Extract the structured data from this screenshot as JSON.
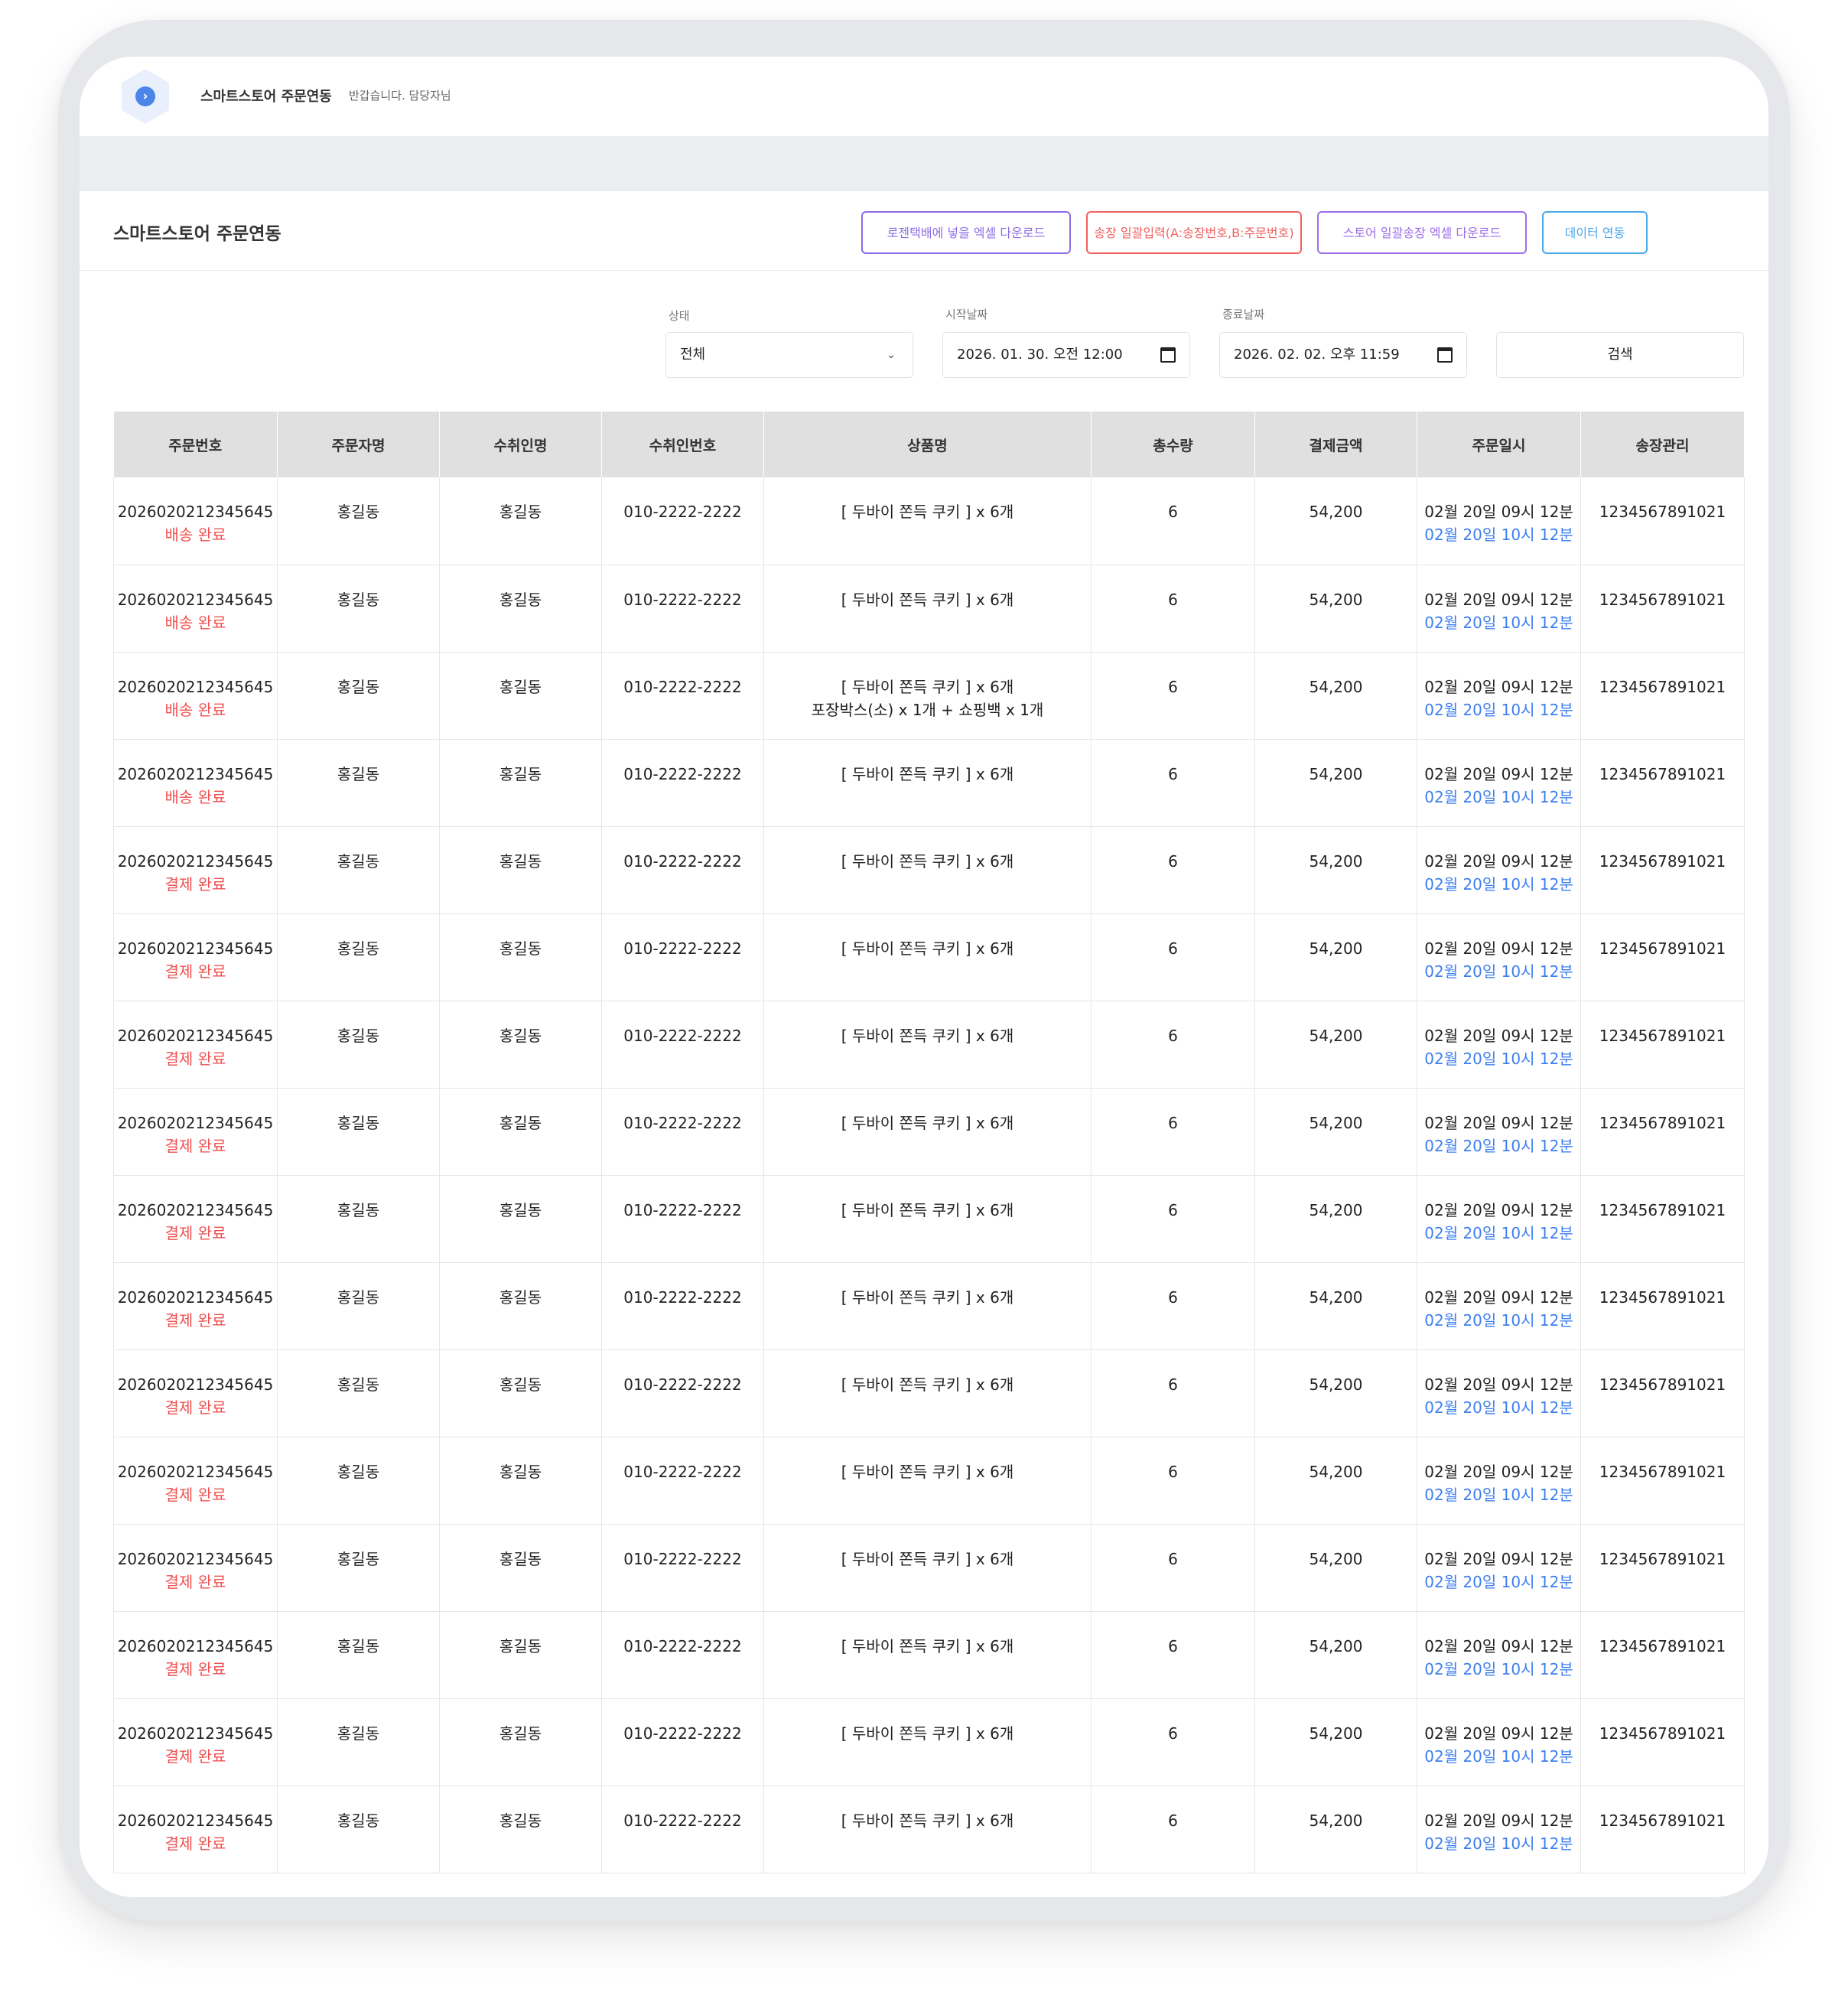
{
  "app": {
    "title": "스마트스토어 주문연동",
    "greeting": "반갑습니다. 담당자님",
    "logo_icon": "chevron-right-icon",
    "logo_glyph": "›"
  },
  "section": {
    "title": "스마트스토어 주문연동",
    "buttons": {
      "excel_download": "로젠택배에 넣을 엑셀 다운로드",
      "invoice_bulk": "송장 일괄입력(A:송장번호,B:주문번호)",
      "store_invoice_download": "스토어 일괄송장 엑셀 다운로드",
      "data_sync": "데이터 연동"
    }
  },
  "filters": {
    "status_label": "상태",
    "status_value": "전체",
    "start_label": "시작날짜",
    "start_value": "2026. 01. 30. 오전 12:00",
    "end_label": "종료날짜",
    "end_value": "2026. 02. 02. 오후 11:59",
    "search_label": "검색",
    "caret_glyph": "⌄"
  },
  "table": {
    "headers": [
      "주문번호",
      "주문자명",
      "수취인명",
      "수취인번호",
      "상품명",
      "총수량",
      "결제금액",
      "주문일시",
      "송장관리"
    ],
    "rows": [
      {
        "order_no": "2026020212345645",
        "status": "배송 완료",
        "buyer": "홍길동",
        "receiver": "홍길동",
        "phone": "010-2222-2222",
        "product": "[ 두바이 쫀득 쿠키 ] x 6개",
        "product_extra": "",
        "qty": "6",
        "amount": "54,200",
        "order_dt": "02월 20일 09시 12분",
        "update_dt": "02월 20일 10시 12분",
        "invoice": "1234567891021"
      },
      {
        "order_no": "2026020212345645",
        "status": "배송 완료",
        "buyer": "홍길동",
        "receiver": "홍길동",
        "phone": "010-2222-2222",
        "product": "[ 두바이 쫀득 쿠키 ] x 6개",
        "product_extra": "",
        "qty": "6",
        "amount": "54,200",
        "order_dt": "02월 20일 09시 12분",
        "update_dt": "02월 20일 10시 12분",
        "invoice": "1234567891021"
      },
      {
        "order_no": "2026020212345645",
        "status": "배송 완료",
        "buyer": "홍길동",
        "receiver": "홍길동",
        "phone": "010-2222-2222",
        "product": "[ 두바이 쫀득 쿠키 ] x 6개",
        "product_extra": "포장박스(소) x 1개 + 쇼핑백 x 1개",
        "qty": "6",
        "amount": "54,200",
        "order_dt": "02월 20일 09시 12분",
        "update_dt": "02월 20일 10시 12분",
        "invoice": "1234567891021"
      },
      {
        "order_no": "2026020212345645",
        "status": "배송 완료",
        "buyer": "홍길동",
        "receiver": "홍길동",
        "phone": "010-2222-2222",
        "product": "[ 두바이 쫀득 쿠키 ] x 6개",
        "product_extra": "",
        "qty": "6",
        "amount": "54,200",
        "order_dt": "02월 20일 09시 12분",
        "update_dt": "02월 20일 10시 12분",
        "invoice": "1234567891021"
      },
      {
        "order_no": "2026020212345645",
        "status": "결제 완료",
        "buyer": "홍길동",
        "receiver": "홍길동",
        "phone": "010-2222-2222",
        "product": "[ 두바이 쫀득 쿠키 ] x 6개",
        "product_extra": "",
        "qty": "6",
        "amount": "54,200",
        "order_dt": "02월 20일 09시 12분",
        "update_dt": "02월 20일 10시 12분",
        "invoice": "1234567891021"
      },
      {
        "order_no": "2026020212345645",
        "status": "결제 완료",
        "buyer": "홍길동",
        "receiver": "홍길동",
        "phone": "010-2222-2222",
        "product": "[ 두바이 쫀득 쿠키 ] x 6개",
        "product_extra": "",
        "qty": "6",
        "amount": "54,200",
        "order_dt": "02월 20일 09시 12분",
        "update_dt": "02월 20일 10시 12분",
        "invoice": "1234567891021"
      },
      {
        "order_no": "2026020212345645",
        "status": "결제 완료",
        "buyer": "홍길동",
        "receiver": "홍길동",
        "phone": "010-2222-2222",
        "product": "[ 두바이 쫀득 쿠키 ] x 6개",
        "product_extra": "",
        "qty": "6",
        "amount": "54,200",
        "order_dt": "02월 20일 09시 12분",
        "update_dt": "02월 20일 10시 12분",
        "invoice": "1234567891021"
      },
      {
        "order_no": "2026020212345645",
        "status": "결제 완료",
        "buyer": "홍길동",
        "receiver": "홍길동",
        "phone": "010-2222-2222",
        "product": "[ 두바이 쫀득 쿠키 ] x 6개",
        "product_extra": "",
        "qty": "6",
        "amount": "54,200",
        "order_dt": "02월 20일 09시 12분",
        "update_dt": "02월 20일 10시 12분",
        "invoice": "1234567891021"
      },
      {
        "order_no": "2026020212345645",
        "status": "결제 완료",
        "buyer": "홍길동",
        "receiver": "홍길동",
        "phone": "010-2222-2222",
        "product": "[ 두바이 쫀득 쿠키 ] x 6개",
        "product_extra": "",
        "qty": "6",
        "amount": "54,200",
        "order_dt": "02월 20일 09시 12분",
        "update_dt": "02월 20일 10시 12분",
        "invoice": "1234567891021"
      },
      {
        "order_no": "2026020212345645",
        "status": "결제 완료",
        "buyer": "홍길동",
        "receiver": "홍길동",
        "phone": "010-2222-2222",
        "product": "[ 두바이 쫀득 쿠키 ] x 6개",
        "product_extra": "",
        "qty": "6",
        "amount": "54,200",
        "order_dt": "02월 20일 09시 12분",
        "update_dt": "02월 20일 10시 12분",
        "invoice": "1234567891021"
      },
      {
        "order_no": "2026020212345645",
        "status": "결제 완료",
        "buyer": "홍길동",
        "receiver": "홍길동",
        "phone": "010-2222-2222",
        "product": "[ 두바이 쫀득 쿠키 ] x 6개",
        "product_extra": "",
        "qty": "6",
        "amount": "54,200",
        "order_dt": "02월 20일 09시 12분",
        "update_dt": "02월 20일 10시 12분",
        "invoice": "1234567891021"
      },
      {
        "order_no": "2026020212345645",
        "status": "결제 완료",
        "buyer": "홍길동",
        "receiver": "홍길동",
        "phone": "010-2222-2222",
        "product": "[ 두바이 쫀득 쿠키 ] x 6개",
        "product_extra": "",
        "qty": "6",
        "amount": "54,200",
        "order_dt": "02월 20일 09시 12분",
        "update_dt": "02월 20일 10시 12분",
        "invoice": "1234567891021"
      },
      {
        "order_no": "2026020212345645",
        "status": "결제 완료",
        "buyer": "홍길동",
        "receiver": "홍길동",
        "phone": "010-2222-2222",
        "product": "[ 두바이 쫀득 쿠키 ] x 6개",
        "product_extra": "",
        "qty": "6",
        "amount": "54,200",
        "order_dt": "02월 20일 09시 12분",
        "update_dt": "02월 20일 10시 12분",
        "invoice": "1234567891021"
      },
      {
        "order_no": "2026020212345645",
        "status": "결제 완료",
        "buyer": "홍길동",
        "receiver": "홍길동",
        "phone": "010-2222-2222",
        "product": "[ 두바이 쫀득 쿠키 ] x 6개",
        "product_extra": "",
        "qty": "6",
        "amount": "54,200",
        "order_dt": "02월 20일 09시 12분",
        "update_dt": "02월 20일 10시 12분",
        "invoice": "1234567891021"
      },
      {
        "order_no": "2026020212345645",
        "status": "결제 완료",
        "buyer": "홍길동",
        "receiver": "홍길동",
        "phone": "010-2222-2222",
        "product": "[ 두바이 쫀득 쿠키 ] x 6개",
        "product_extra": "",
        "qty": "6",
        "amount": "54,200",
        "order_dt": "02월 20일 09시 12분",
        "update_dt": "02월 20일 10시 12분",
        "invoice": "1234567891021"
      },
      {
        "order_no": "2026020212345645",
        "status": "결제 완료",
        "buyer": "홍길동",
        "receiver": "홍길동",
        "phone": "010-2222-2222",
        "product": "[ 두바이 쫀득 쿠키 ] x 6개",
        "product_extra": "",
        "qty": "6",
        "amount": "54,200",
        "order_dt": "02월 20일 09시 12분",
        "update_dt": "02월 20일 10시 12분",
        "invoice": "1234567891021"
      }
    ]
  },
  "colors": {
    "status_red": "#f05050",
    "datetime_blue": "#3d7ff0",
    "header_gray": "#e0e0e0",
    "btn_purple": "#8b6de6",
    "btn_red": "#f06060",
    "btn_blue": "#4ca8ea"
  }
}
